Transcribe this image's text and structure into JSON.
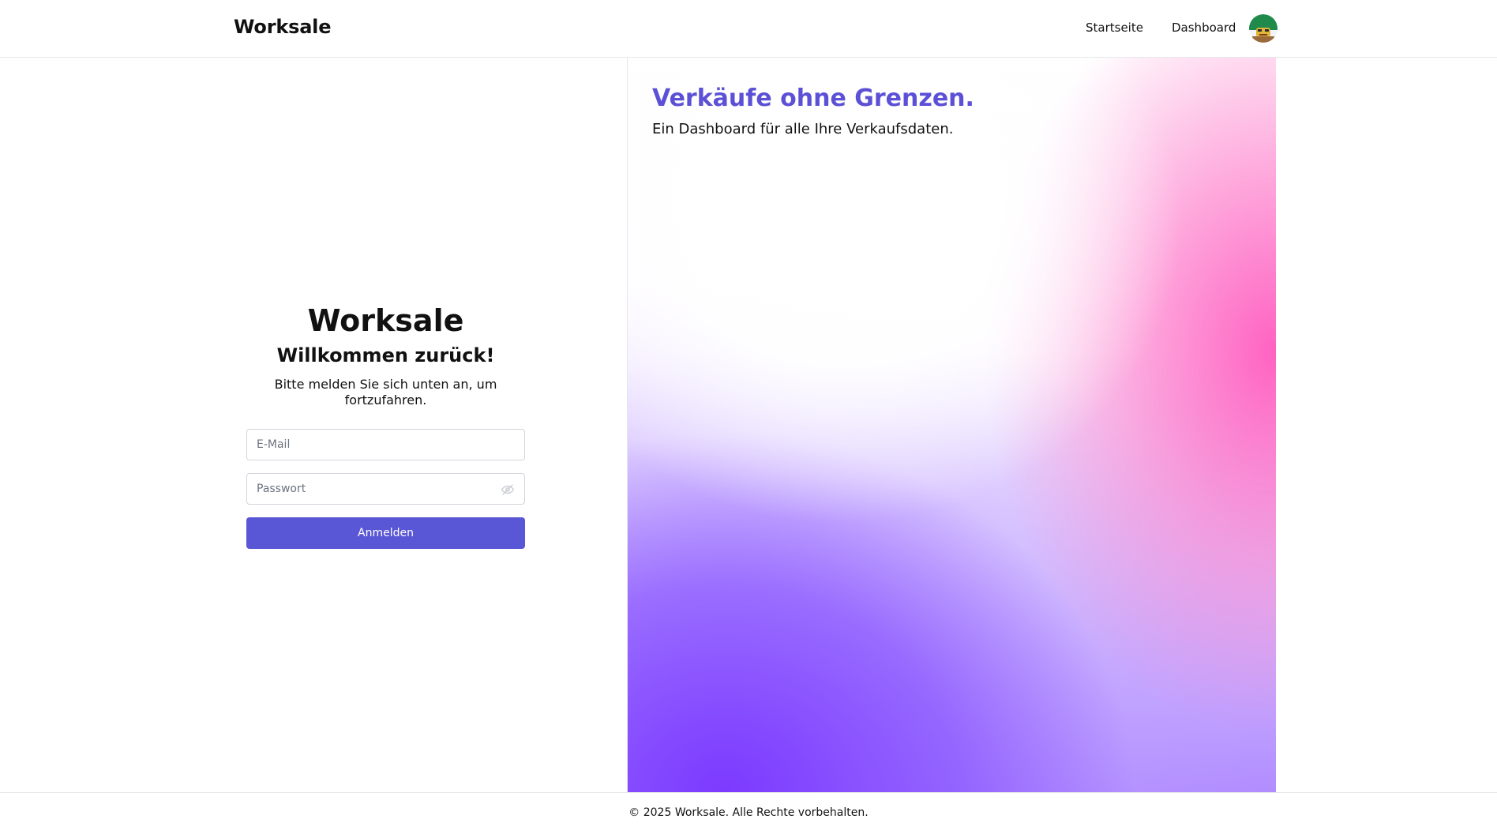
{
  "header": {
    "brand": "Worksale",
    "nav": {
      "home": "Startseite",
      "dashboard": "Dashboard"
    },
    "avatar_icon": "user-avatar-icon"
  },
  "login": {
    "brand": "Worksale",
    "welcome": "Willkommen zurück!",
    "subtitle": "Bitte melden Sie sich unten an, um fortzufahren.",
    "email": {
      "placeholder": "E-Mail",
      "value": ""
    },
    "password": {
      "placeholder": "Passwort",
      "value": ""
    },
    "submit_label": "Anmelden",
    "accent_color": "#5a57d6"
  },
  "hero": {
    "title": "Verkäufe ohne Grenzen.",
    "subtitle": "Ein Dashboard für alle Ihre Verkaufsdaten.",
    "title_color": "#5b50d6"
  },
  "footer": {
    "text": "© 2025 Worksale. Alle Rechte vorbehalten."
  }
}
